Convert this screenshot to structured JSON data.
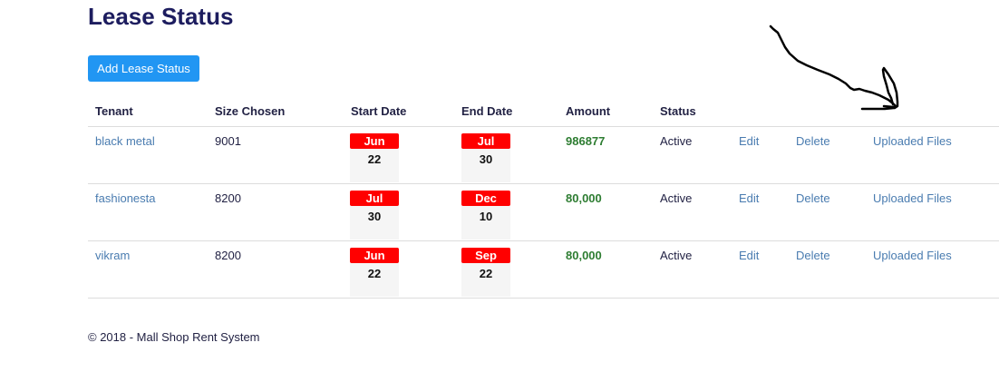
{
  "page_title": "Lease Status",
  "add_button_label": "Add Lease Status",
  "columns": {
    "tenant": "Tenant",
    "size": "Size Chosen",
    "start": "Start Date",
    "end": "End Date",
    "amount": "Amount",
    "status": "Status"
  },
  "rows": [
    {
      "tenant": "black metal",
      "size": "9001",
      "start_month": "Jun",
      "start_day": "22",
      "end_month": "Jul",
      "end_day": "30",
      "amount": "986877",
      "status": "Active",
      "edit": "Edit",
      "delete": "Delete",
      "files": "Uploaded Files"
    },
    {
      "tenant": "fashionesta",
      "size": "8200",
      "start_month": "Jul",
      "start_day": "30",
      "end_month": "Dec",
      "end_day": "10",
      "amount": "80,000",
      "status": "Active",
      "edit": "Edit",
      "delete": "Delete",
      "files": "Uploaded Files"
    },
    {
      "tenant": "vikram",
      "size": "8200",
      "start_month": "Jun",
      "start_day": "22",
      "end_month": "Sep",
      "end_day": "22",
      "amount": "80,000",
      "status": "Active",
      "edit": "Edit",
      "delete": "Delete",
      "files": "Uploaded Files"
    }
  ],
  "footer": "© 2018 - Mall Shop Rent System",
  "colors": {
    "title": "#1d1d5f",
    "button": "#2196f3",
    "month_badge": "#ff0000",
    "amount": "#2e7d32",
    "link": "#4a7cb0"
  },
  "annotation_icon": "hand-drawn-arrow-icon"
}
